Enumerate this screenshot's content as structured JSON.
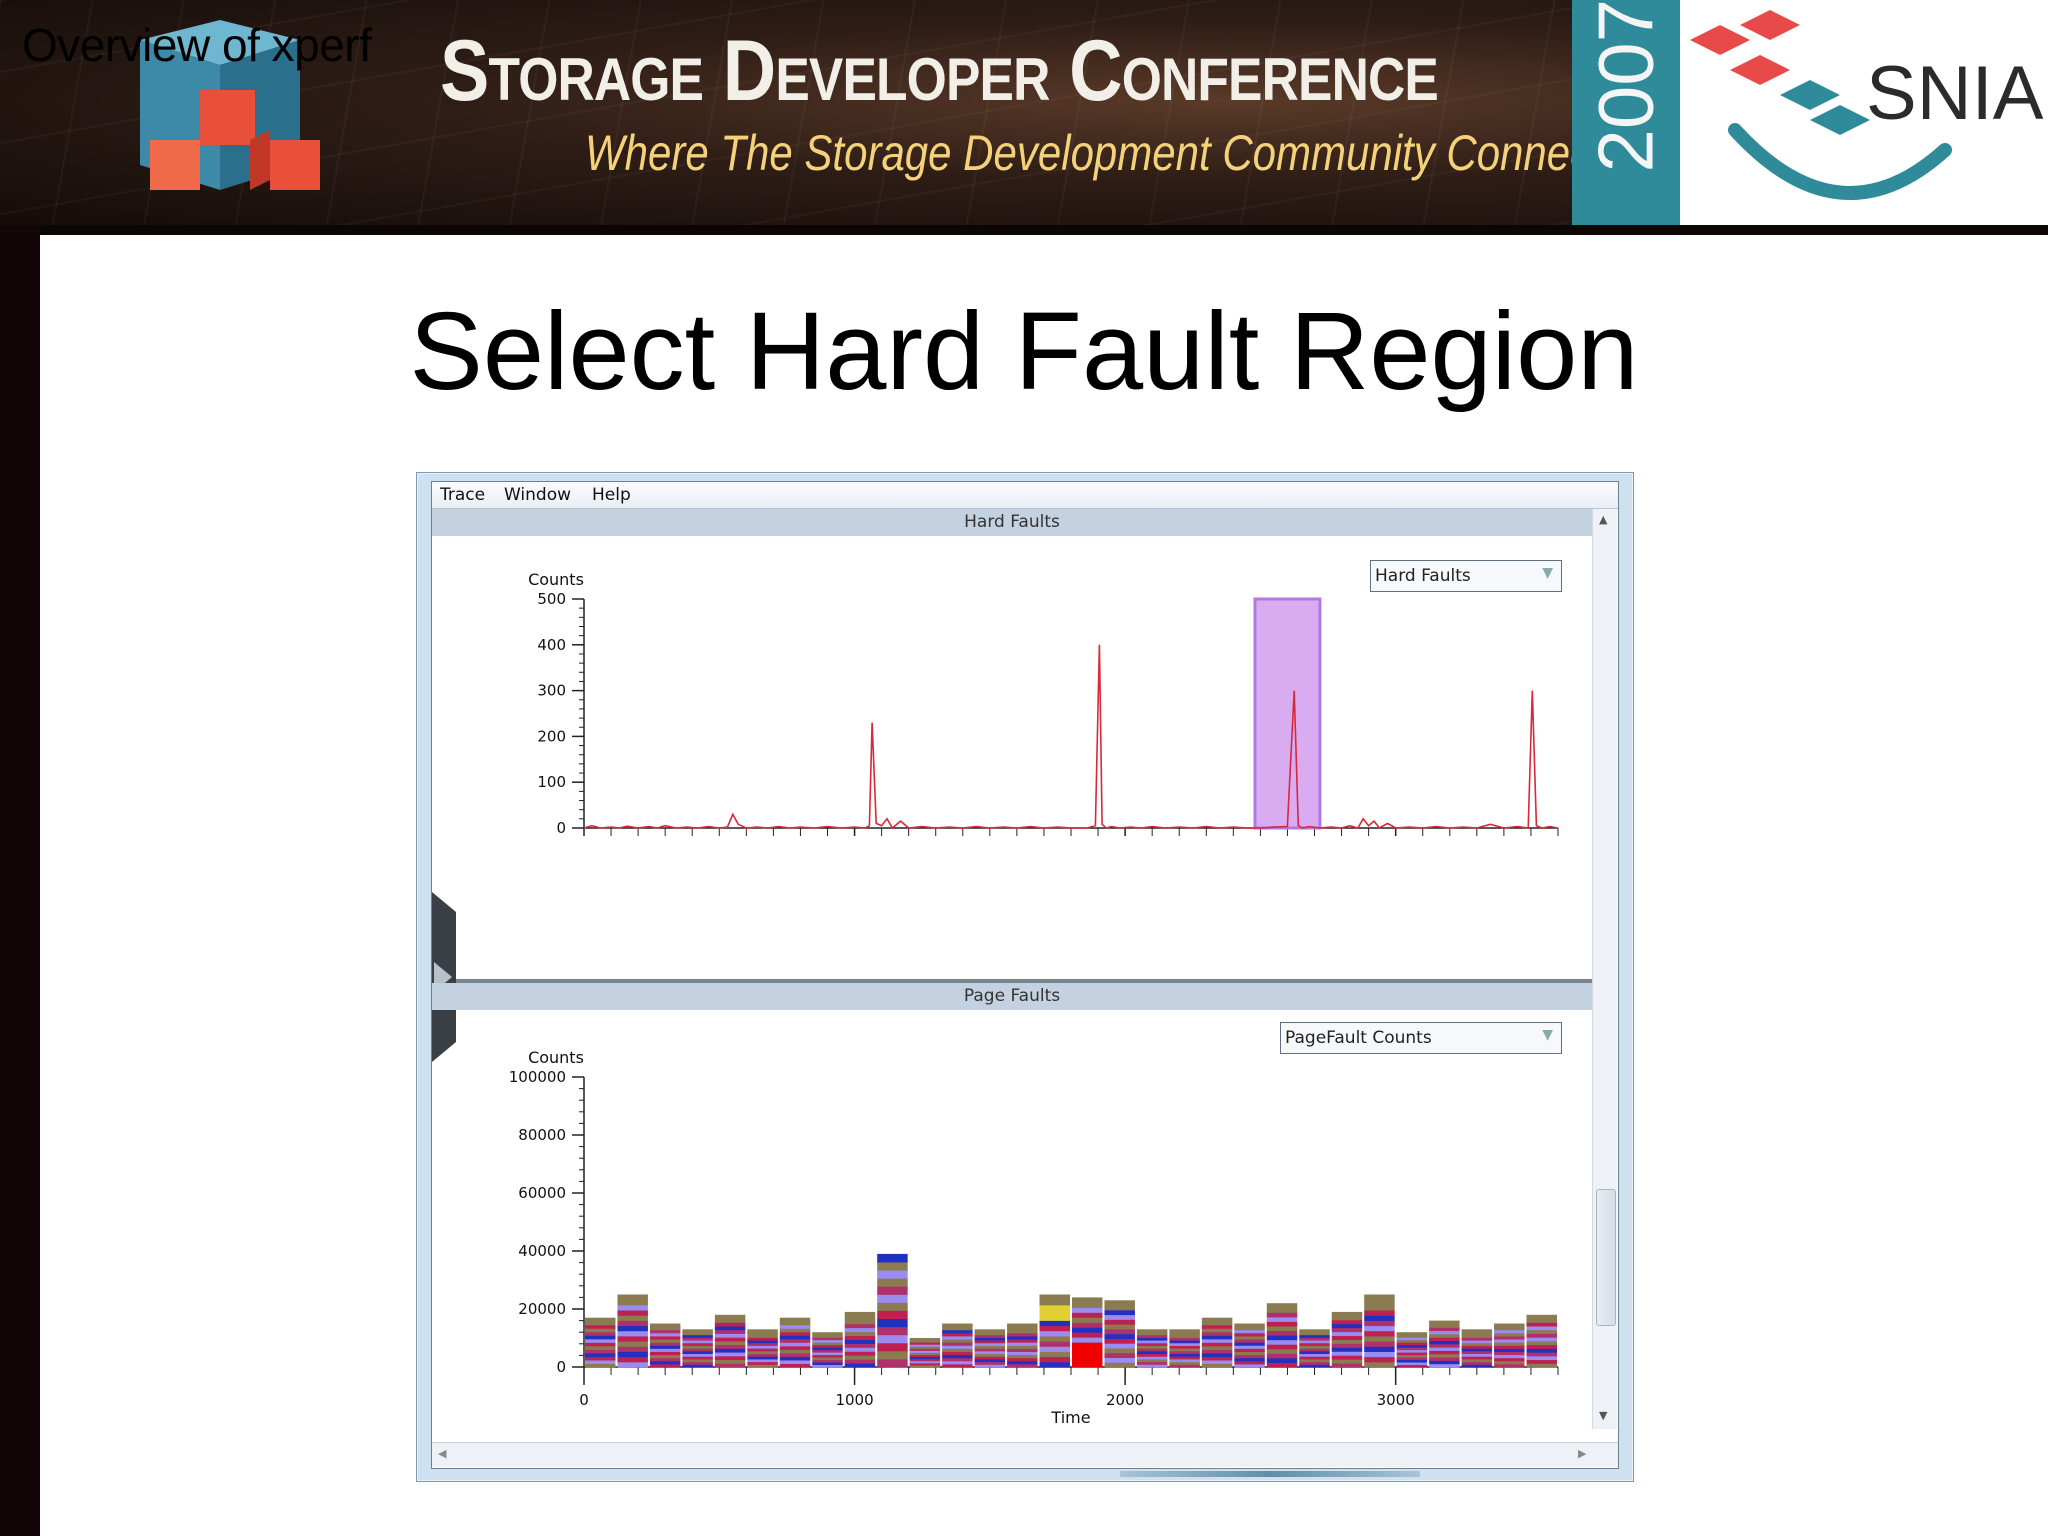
{
  "banner": {
    "overview_label": "Overview of xperf",
    "conference_title": "Storage Developer Conference",
    "tagline": "Where The Storage Development Community Connects",
    "year": "2007",
    "org": "SNIA"
  },
  "slide": {
    "title": "Select Hard Fault Region"
  },
  "menu": {
    "items": [
      "Trace",
      "Window",
      "Help"
    ]
  },
  "panels": {
    "hard_faults": {
      "header": "Hard Faults",
      "dropdown_value": "Hard Faults"
    },
    "page_faults": {
      "header": "Page Faults",
      "dropdown_value": "PageFault Counts"
    }
  },
  "colors": {
    "line": "#d8283a",
    "selection": "#d9acf2",
    "stack_palette": [
      "#8a7c50",
      "#9a8cf0",
      "#c02050",
      "#2030c0",
      "#b0306a",
      "#e0d030",
      "#f00000"
    ]
  },
  "chart_data": [
    {
      "type": "line",
      "title": "",
      "ylabel": "Counts",
      "xlabel": "Time",
      "xlim": [
        0,
        3600
      ],
      "ylim": [
        0,
        500
      ],
      "yticks": [
        0,
        100,
        200,
        300,
        400,
        500
      ],
      "xticks": [
        0,
        1000,
        2000,
        3000
      ],
      "selection_range": [
        2480,
        2720
      ],
      "series": [
        {
          "x": [
            0,
            30,
            60,
            100,
            130,
            160,
            200,
            240,
            270,
            300,
            340,
            380,
            420,
            460,
            500,
            530,
            550,
            570,
            600,
            640,
            680,
            720,
            760,
            800,
            850,
            900,
            950,
            1000,
            1040,
            1055,
            1065,
            1080,
            1100,
            1120,
            1140,
            1170,
            1200,
            1250,
            1300,
            1350,
            1400,
            1450,
            1500,
            1550,
            1600,
            1650,
            1700,
            1750,
            1800,
            1860,
            1890,
            1905,
            1915,
            1930,
            1950,
            1980,
            2020,
            2060,
            2100,
            2150,
            2200,
            2250,
            2300,
            2350,
            2400,
            2450,
            2500,
            2550,
            2600,
            2625,
            2640,
            2655,
            2680,
            2720,
            2760,
            2800,
            2830,
            2860,
            2880,
            2900,
            2920,
            2940,
            2970,
            3000,
            3050,
            3100,
            3150,
            3200,
            3250,
            3300,
            3350,
            3400,
            3450,
            3490,
            3505,
            3520,
            3540,
            3570,
            3600
          ],
          "y": [
            0,
            5,
            0,
            2,
            0,
            4,
            0,
            3,
            0,
            5,
            0,
            2,
            0,
            3,
            0,
            2,
            30,
            8,
            0,
            2,
            0,
            3,
            0,
            2,
            0,
            3,
            0,
            2,
            0,
            5,
            230,
            10,
            5,
            20,
            0,
            15,
            0,
            3,
            0,
            2,
            0,
            3,
            0,
            2,
            0,
            3,
            0,
            2,
            0,
            0,
            5,
            400,
            8,
            0,
            3,
            0,
            2,
            0,
            3,
            0,
            2,
            0,
            3,
            0,
            2,
            0,
            0,
            2,
            3,
            300,
            5,
            0,
            3,
            0,
            2,
            0,
            5,
            0,
            20,
            5,
            15,
            0,
            10,
            0,
            2,
            0,
            3,
            0,
            2,
            0,
            8,
            0,
            3,
            0,
            300,
            5,
            0,
            3,
            0
          ]
        }
      ]
    },
    {
      "type": "bar",
      "title": "",
      "ylabel": "Counts",
      "xlabel": "Time",
      "xlim": [
        0,
        3600
      ],
      "ylim": [
        0,
        100000
      ],
      "yticks": [
        0,
        20000,
        40000,
        60000,
        80000,
        100000
      ],
      "xticks": [
        0,
        1000,
        2000,
        3000
      ],
      "bin_width": 120,
      "values": [
        17000,
        25000,
        15000,
        13000,
        18000,
        13000,
        17000,
        12000,
        19000,
        39000,
        10000,
        15000,
        13000,
        15000,
        25000,
        24000,
        23000,
        13000,
        13000,
        17000,
        15000,
        22000,
        13000,
        19000,
        25000,
        12000,
        16000,
        13000,
        15000,
        18000
      ]
    }
  ]
}
